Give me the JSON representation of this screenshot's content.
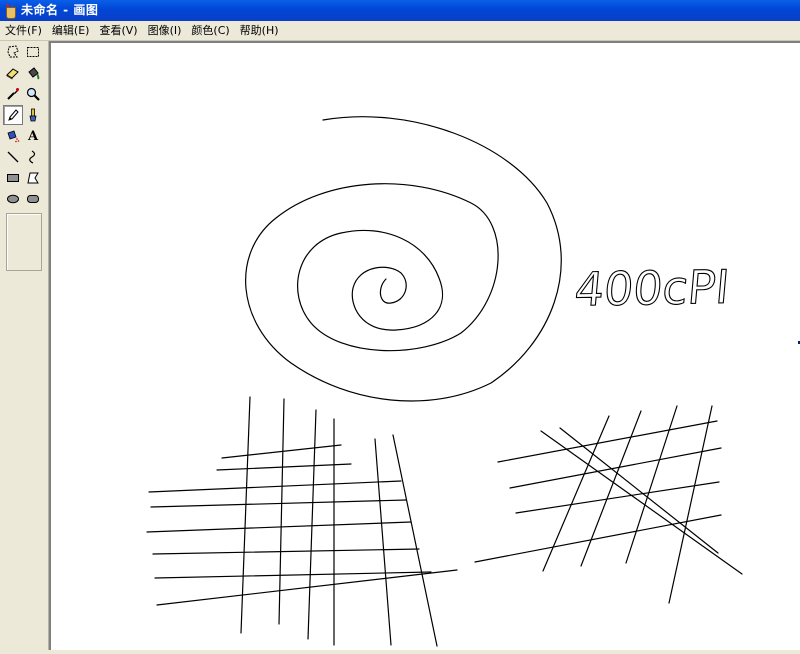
{
  "window": {
    "title": "未命名 - 画图"
  },
  "menu": [
    {
      "label": "文件(F)"
    },
    {
      "label": "编辑(E)"
    },
    {
      "label": "查看(V)"
    },
    {
      "label": "图像(I)"
    },
    {
      "label": "颜色(C)"
    },
    {
      "label": "帮助(H)"
    }
  ],
  "tools": [
    {
      "name": "free-form-select-icon"
    },
    {
      "name": "rectangle-select-icon"
    },
    {
      "name": "eraser-icon"
    },
    {
      "name": "fill-bucket-icon"
    },
    {
      "name": "color-picker-icon"
    },
    {
      "name": "magnifier-icon"
    },
    {
      "name": "pencil-icon",
      "selected": true
    },
    {
      "name": "brush-icon"
    },
    {
      "name": "airbrush-icon"
    },
    {
      "name": "text-icon",
      "glyph": "A"
    },
    {
      "name": "line-icon"
    },
    {
      "name": "curve-icon"
    },
    {
      "name": "rectangle-icon"
    },
    {
      "name": "polygon-icon"
    },
    {
      "name": "ellipse-icon"
    },
    {
      "name": "rounded-rectangle-icon"
    }
  ],
  "canvas": {
    "handwritten_text": "400cPI"
  },
  "colors": {
    "title_bar": "#0a5fe8",
    "window_bg": "#ece9d8",
    "canvas_bg": "#ffffff",
    "ink": "#000000"
  }
}
